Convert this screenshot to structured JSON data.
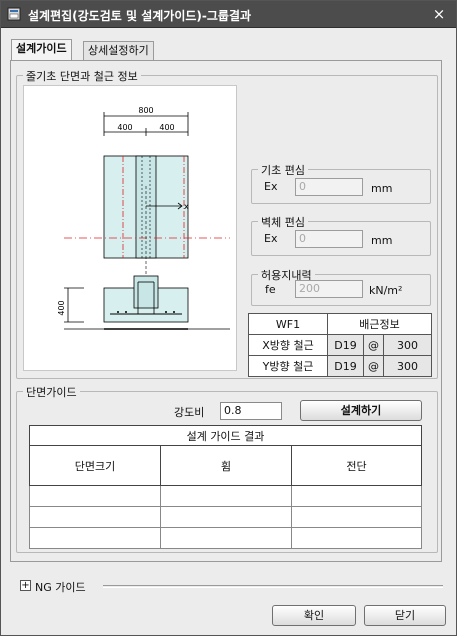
{
  "window": {
    "title": "설계편집(강도검토 및 설계가이드)-그룹결과",
    "close_glyph": "×"
  },
  "tabs": [
    {
      "label": "설계가이드",
      "active": true
    },
    {
      "label": "상세설정하기",
      "active": false
    }
  ],
  "section_group": {
    "label": "줄기초 단면과 철근 정보",
    "drawing": {
      "total_width": "800",
      "half_left": "400",
      "half_right": "400",
      "depth": "400",
      "axis_x": "x"
    }
  },
  "foundation_eccentricity": {
    "label": "기초 편심",
    "field_label": "Ex",
    "value": "0",
    "unit": "mm"
  },
  "wall_eccentricity": {
    "label": "벽체 편심",
    "field_label": "Ex",
    "value": "0",
    "unit": "mm"
  },
  "bearing_capacity": {
    "label": "허용지내력",
    "field_label": "fe",
    "value": "200",
    "unit": "kN/m²"
  },
  "rebar_table": {
    "name": "WF1",
    "header": "배근정보",
    "rows": [
      {
        "label": "X방향 철근",
        "bar": "D19",
        "at": "@",
        "spacing": "300"
      },
      {
        "label": "Y방향 철근",
        "bar": "D19",
        "at": "@",
        "spacing": "300"
      }
    ]
  },
  "section_guide": {
    "label": "단면가이드",
    "strength_ratio_label": "강도비",
    "strength_ratio_value": "0.8",
    "design_button": "설계하기",
    "result_title": "설계 가이드 결과",
    "columns": [
      "단면크기",
      "휨",
      "전단"
    ],
    "rows": [
      [
        "",
        "",
        ""
      ],
      [
        "",
        "",
        ""
      ],
      [
        "",
        "",
        ""
      ]
    ]
  },
  "ng_guide": {
    "expand_glyph": "+",
    "label": "NG 가이드"
  },
  "footer": {
    "ok_button": "확인",
    "close_button": "닫기"
  }
}
